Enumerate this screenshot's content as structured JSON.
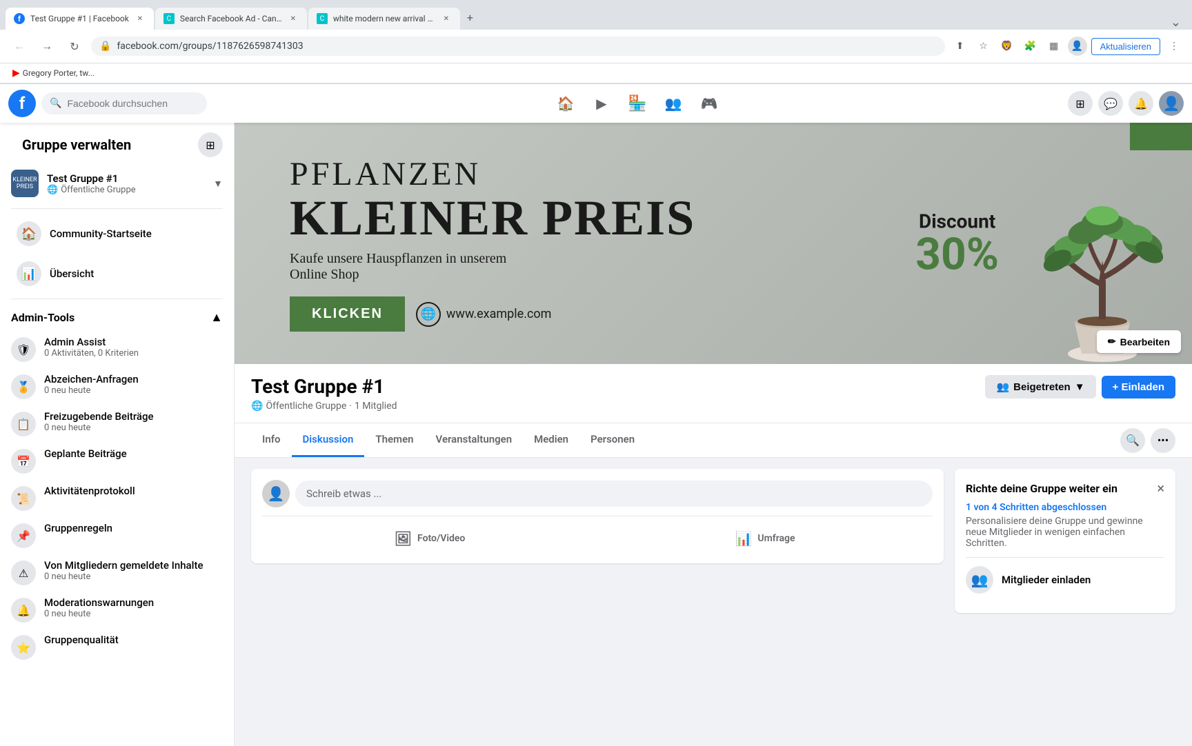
{
  "browser": {
    "tabs": [
      {
        "id": 1,
        "title": "Test Gruppe #1 | Facebook",
        "favicon": "fb",
        "active": true
      },
      {
        "id": 2,
        "title": "Search Facebook Ad - Canva",
        "favicon": "canva",
        "active": false
      },
      {
        "id": 3,
        "title": "white modern new arrival watc...",
        "favicon": "canva2",
        "active": false
      }
    ],
    "address": "facebook.com/groups/1187626598741303",
    "new_tab_label": "+",
    "aktualisieren": "Aktualisieren",
    "bookmark": "Gregory Porter, tw..."
  },
  "fb_header": {
    "search_placeholder": "Facebook durchsuchen",
    "nav_icons": [
      "🏠",
      "▶",
      "🏪",
      "👥",
      "⬛"
    ],
    "right_icons": [
      "⊞",
      "💬",
      "🔔"
    ]
  },
  "sidebar": {
    "title": "Gruppe verwalten",
    "icon_btn": "⊞",
    "group_name": "Test Gruppe #1",
    "group_type": "Öffentliche Gruppe",
    "nav_items": [
      {
        "label": "Community-Startseite",
        "icon": "🏠"
      },
      {
        "label": "Übersicht",
        "icon": "📊"
      }
    ],
    "admin_tools_title": "Admin-Tools",
    "admin_items": [
      {
        "label": "Admin Assist",
        "sub": "0 Aktivitäten, 0 Kriterien",
        "icon": "🛡"
      },
      {
        "label": "Abzeichen-Anfragen",
        "sub": "0 neu heute",
        "icon": "🏅"
      },
      {
        "label": "Freizugebende Beiträge",
        "sub": "0 neu heute",
        "icon": "📋"
      },
      {
        "label": "Geplante Beiträge",
        "sub": "",
        "icon": "📅"
      },
      {
        "label": "Aktivitätenprotokoll",
        "sub": "",
        "icon": "📜"
      },
      {
        "label": "Gruppenregeln",
        "sub": "",
        "icon": "📌"
      },
      {
        "label": "Von Mitgliedern gemeldete Inhalte",
        "sub": "0 neu heute",
        "icon": "⚠"
      },
      {
        "label": "Moderationswarnungen",
        "sub": "0 neu heute",
        "icon": "🔔"
      },
      {
        "label": "Gruppenqualität",
        "sub": "",
        "icon": "⭐"
      }
    ]
  },
  "banner": {
    "pflanzen": "PFLANZEN",
    "kleiner": "KLEINER PREIS",
    "subtitle1": "Kaufe unsere Hauspflanzen in unserem",
    "subtitle2": "Online Shop",
    "btn_label": "KLICKEN",
    "url": "www.example.com",
    "discount_label": "Discount",
    "discount_pct": "30%",
    "edit_btn": "✏ Bearbeiten"
  },
  "group_info": {
    "title": "Test Gruppe #1",
    "type": "Öffentliche Gruppe",
    "dot": "·",
    "members": "1 Mitglied",
    "btn_joined": "Beigetreten",
    "btn_invite": "+ Einladen"
  },
  "tabs": {
    "items": [
      "Info",
      "Diskussion",
      "Themen",
      "Veranstaltungen",
      "Medien",
      "Personen"
    ],
    "active": "Diskussion"
  },
  "post_box": {
    "placeholder": "Schreib etwas ...",
    "actions": [
      {
        "label": "Foto/Video",
        "icon": "🖼"
      },
      {
        "label": "Umfrage",
        "icon": "📊"
      }
    ]
  },
  "setup_card": {
    "title": "Richte deine Gruppe weiter ein",
    "close": "×",
    "progress": "1 von 4 Schritten abgeschlossen",
    "desc": "Personalisiere deine Gruppe und gewinne neue Mitglieder in wenigen einfachen Schritten.",
    "item_label": "Mitglieder einladen",
    "item_icon": "👥"
  }
}
